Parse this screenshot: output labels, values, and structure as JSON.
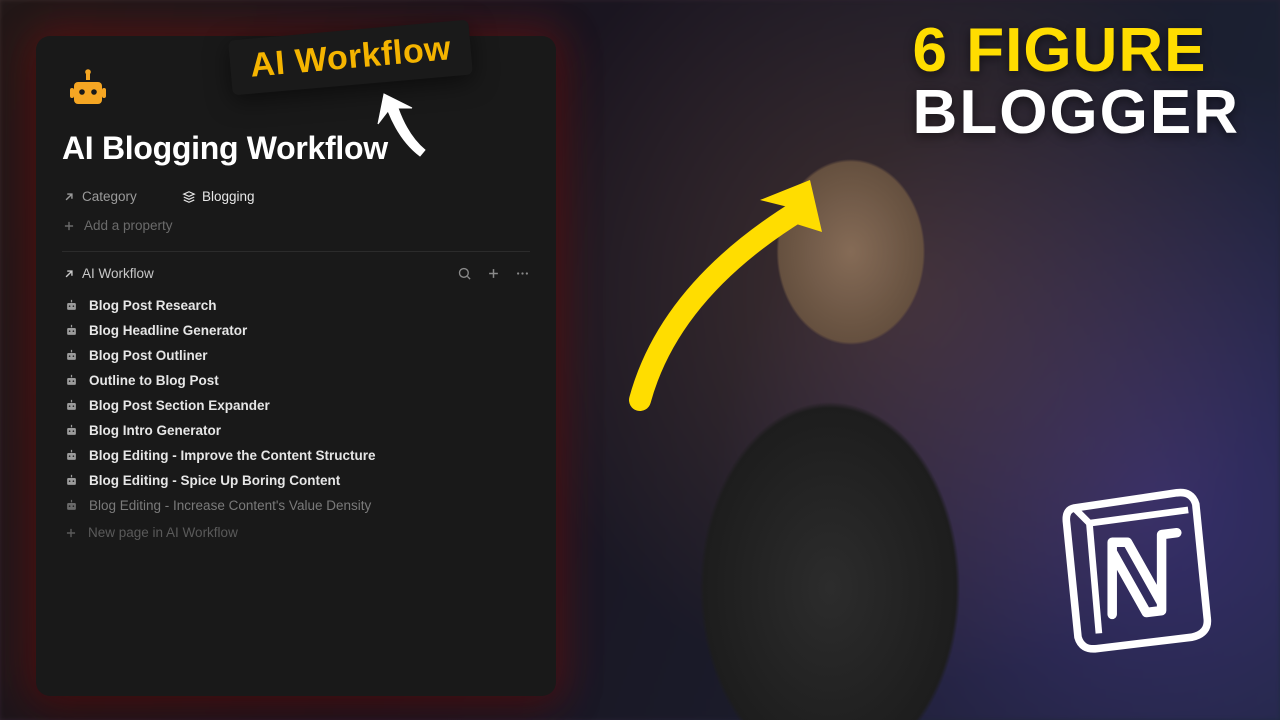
{
  "overlay": {
    "label": "AI Workflow",
    "headline_line1": "6 FIGURE",
    "headline_line2": "BLOGGER"
  },
  "page": {
    "icon": "robot-icon",
    "title": "AI Blogging Workflow",
    "properties": {
      "category_label": "Category",
      "category_value": "Blogging",
      "add_property_label": "Add a property"
    }
  },
  "database": {
    "title": "AI Workflow",
    "items": [
      {
        "label": "Blog Post Research"
      },
      {
        "label": "Blog Headline Generator"
      },
      {
        "label": "Blog Post Outliner"
      },
      {
        "label": "Outline to Blog Post"
      },
      {
        "label": "Blog Post Section Expander"
      },
      {
        "label": "Blog Intro Generator"
      },
      {
        "label": "Blog Editing - Improve the Content Structure"
      },
      {
        "label": "Blog Editing - Spice Up Boring Content"
      },
      {
        "label": "Blog Editing - Increase Content's Value Density"
      }
    ],
    "new_page_label": "New page in AI Workflow"
  },
  "colors": {
    "accent_yellow": "#ffdd00",
    "icon_amber": "#f5a623",
    "panel_bg": "#191919"
  }
}
